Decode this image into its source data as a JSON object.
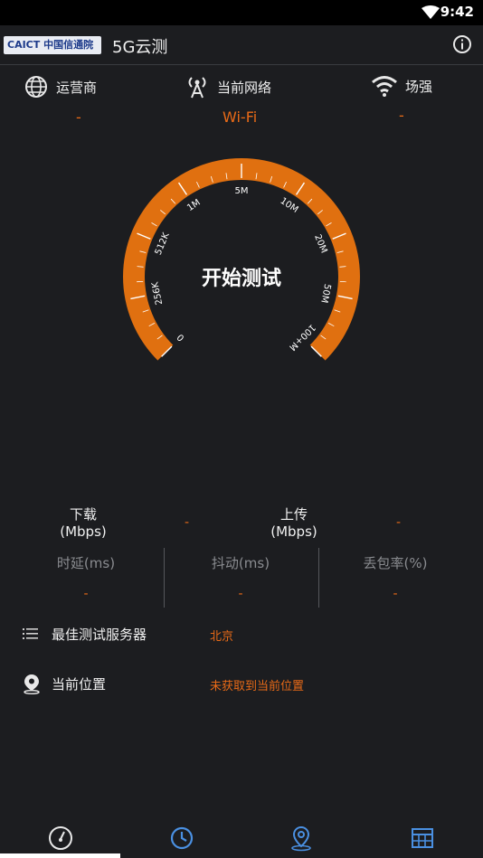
{
  "status_bar": {
    "time": "9:42"
  },
  "app_bar": {
    "logo_text": "CAICT 中国信通院",
    "title": "5G云测"
  },
  "info": {
    "operator": {
      "label": "运营商",
      "value": "-"
    },
    "network": {
      "label": "当前网络",
      "value": "Wi-Fi"
    },
    "signal": {
      "label": "场强",
      "value": "-"
    }
  },
  "gauge": {
    "start_label": "开始测试",
    "ticks": [
      "0",
      "256K",
      "512K",
      "1M",
      "5M",
      "10M",
      "20M",
      "50M",
      "100+M"
    ],
    "accent_color": "#e07010"
  },
  "metrics": {
    "download": {
      "label": "下载",
      "unit": "(Mbps)",
      "value": "-"
    },
    "upload": {
      "label": "上传",
      "unit": "(Mbps)",
      "value": "-"
    },
    "latency": {
      "label": "时延(ms)",
      "value": "-"
    },
    "jitter": {
      "label": "抖动(ms)",
      "value": "-"
    },
    "loss": {
      "label": "丢包率(%)",
      "value": "-"
    }
  },
  "server": {
    "label": "最佳测试服务器",
    "value": "北京",
    "icon": "list-icon"
  },
  "location": {
    "label": "当前位置",
    "value": "未获取到当前位置",
    "icon": "location-pin-icon"
  },
  "nav": [
    {
      "name": "speedometer-icon",
      "color": "#e8e8e8"
    },
    {
      "name": "history-clock-icon",
      "color": "#4a90e2"
    },
    {
      "name": "map-pin-icon",
      "color": "#4a90e2"
    },
    {
      "name": "table-grid-icon",
      "color": "#4a90e2"
    }
  ]
}
